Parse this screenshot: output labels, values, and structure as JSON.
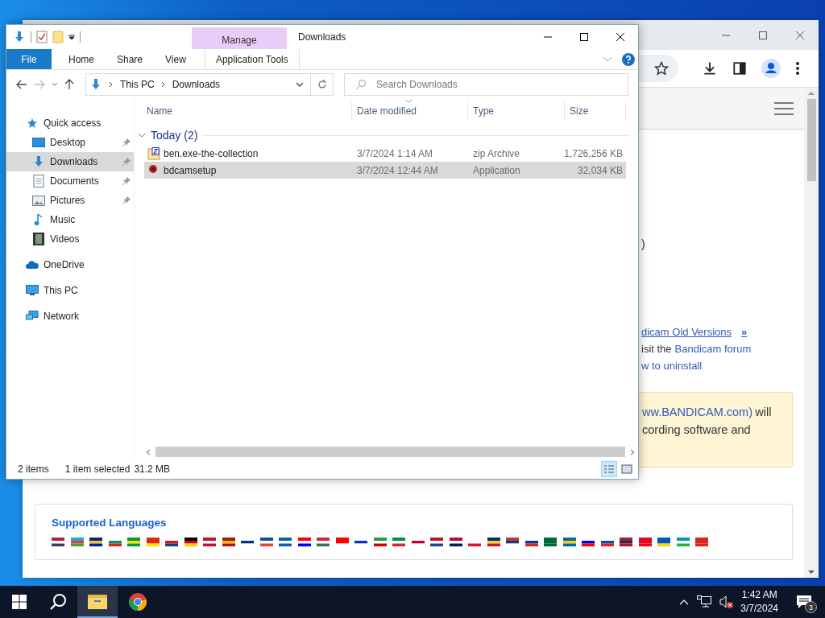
{
  "browser": {
    "paren_fragment": ")",
    "old_versions_link": "dicam Old Versions",
    "old_versions_arrow": "»",
    "forum_prefix": "isit the",
    "forum_link": "Bandicam forum",
    "uninstall_link": "w to uninstall",
    "notice": {
      "link": "ww.BANDICAM.com)",
      "line1_rest": "will",
      "line2": "cording software and"
    },
    "languages": {
      "title": "Supported Languages"
    }
  },
  "explorer": {
    "title": "Downloads",
    "context_tab": "Manage",
    "ribbon_tabs": [
      {
        "label": "File",
        "kind": "file",
        "selected": false
      },
      {
        "label": "Home",
        "kind": "plain",
        "selected": false
      },
      {
        "label": "Share",
        "kind": "plain",
        "selected": false
      },
      {
        "label": "View",
        "kind": "plain",
        "selected": false
      },
      {
        "label": "Application Tools",
        "kind": "context",
        "selected": false
      }
    ],
    "address": {
      "path": [
        "This PC",
        "Downloads"
      ]
    },
    "search": {
      "placeholder": "Search Downloads"
    },
    "nav": [
      {
        "label": "Quick access",
        "kind": "quick",
        "selected": false,
        "children": [
          {
            "label": "Desktop",
            "kind": "desktop",
            "pinned": true,
            "selected": false
          },
          {
            "label": "Downloads",
            "kind": "downloads",
            "pinned": true,
            "selected": true
          },
          {
            "label": "Documents",
            "kind": "documents",
            "pinned": true,
            "selected": false
          },
          {
            "label": "Pictures",
            "kind": "pictures",
            "pinned": true,
            "selected": false
          },
          {
            "label": "Music",
            "kind": "music",
            "pinned": false,
            "selected": false
          },
          {
            "label": "Videos",
            "kind": "videos",
            "pinned": false,
            "selected": false
          }
        ]
      },
      {
        "label": "OneDrive",
        "kind": "cloud",
        "selected": false
      },
      {
        "label": "This PC",
        "kind": "pc",
        "selected": false
      },
      {
        "label": "Network",
        "kind": "network",
        "selected": false
      }
    ],
    "columns": [
      "Name",
      "Date modified",
      "Type",
      "Size"
    ],
    "group": {
      "label": "Today (2)",
      "expanded": true
    },
    "rows": [
      {
        "name": "ben.exe-the-collection",
        "kind": "zip",
        "date": "3/7/2024 1:14 AM",
        "type": "zip Archive",
        "size": "1,726,256 KB",
        "selected": false
      },
      {
        "name": "bdcamsetup",
        "kind": "app",
        "date": "3/7/2024 12:44 AM",
        "type": "Application",
        "size": "32,034 KB",
        "selected": true
      }
    ],
    "status": {
      "count": "2 items",
      "selection": "1 item selected",
      "size": "31.2 MB"
    },
    "views": [
      {
        "kind": "details",
        "selected": true
      },
      {
        "kind": "large-icons",
        "selected": false
      }
    ]
  },
  "taskbar": {
    "apps": [
      {
        "kind": "explorer",
        "active": true
      },
      {
        "kind": "chrome",
        "active": false
      }
    ],
    "tray": {
      "volume_muted": true,
      "time": "1:42 AM",
      "date": "3/7/2024",
      "notifications": "3"
    }
  }
}
